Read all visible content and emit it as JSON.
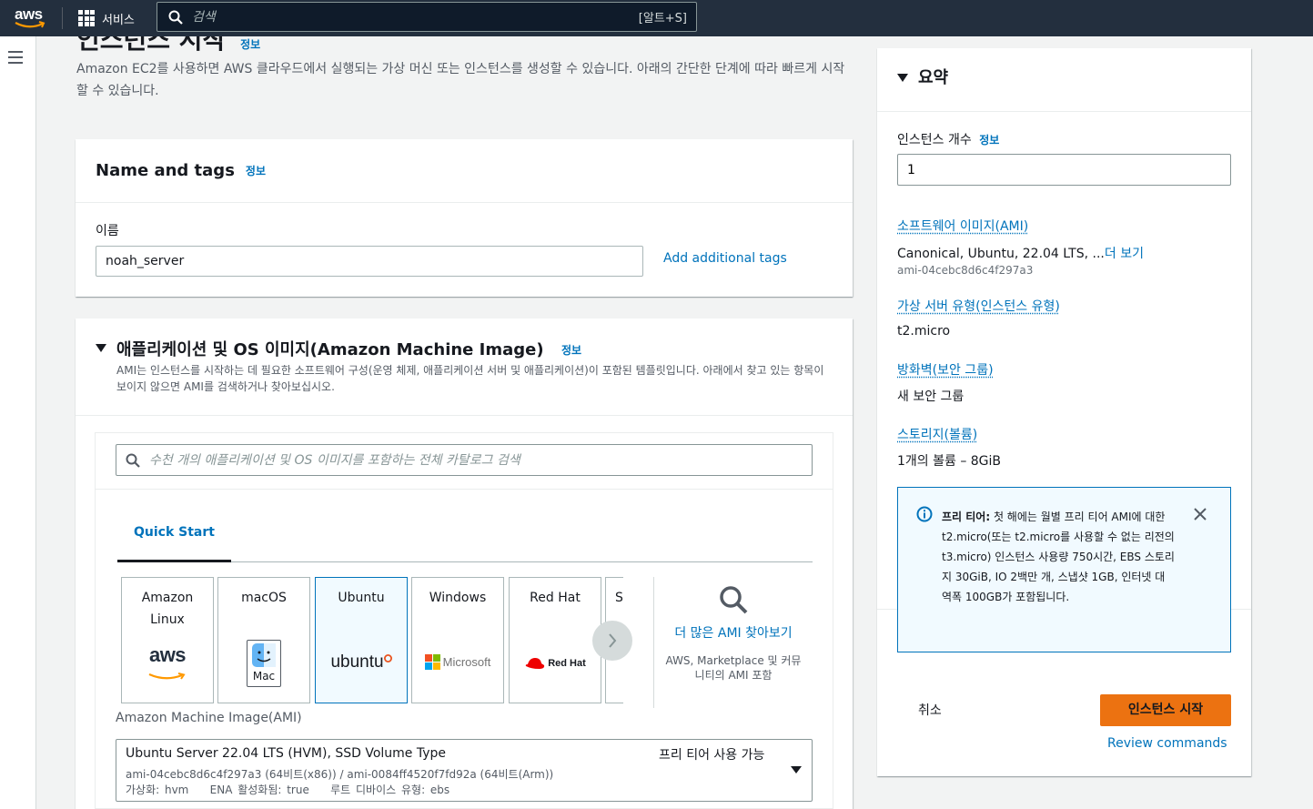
{
  "topnav": {
    "logo": "aws",
    "services_label": "서비스",
    "search_placeholder": "검색",
    "search_shortcut": "[알트+S]"
  },
  "page": {
    "title": "인스턴스 시작",
    "title_info": "정보",
    "intro": "Amazon EC2를 사용하면 AWS 클라우드에서 실행되는 가상 머신 또는 인스턴스를 생성할 수 있습니다. 아래의 간단한 단계에 따라 빠르게 시작할 수 있습니다."
  },
  "name_tags": {
    "title": "Name and tags",
    "info": "정보",
    "name_label": "이름",
    "name_value": "noah_server",
    "add_tags": "Add additional tags"
  },
  "ami": {
    "title": "애플리케이션 및 OS 이미지(Amazon Machine Image)",
    "info": "정보",
    "description": "AMI는 인스턴스를 시작하는 데 필요한 소프트웨어 구성(운영 체제, 애플리케이션 서버 및 애플리케이션)이 포함된 템플릿입니다. 아래에서 찾고 있는 항목이 보이지 않으면 AMI를 검색하거나 찾아보십시오.",
    "search_placeholder": "수천 개의 애플리케이션 및 OS 이미지를 포함하는 전체 카탈로그 검색",
    "tab_label": "Quick Start",
    "os_tiles": [
      {
        "name": "Amazon Linux",
        "logo": "aws"
      },
      {
        "name": "macOS",
        "logo": "Mac"
      },
      {
        "name": "Ubuntu",
        "logo": "ubuntu"
      },
      {
        "name": "Windows",
        "logo": "Microsoft"
      },
      {
        "name": "Red Hat",
        "logo": "Red Hat"
      },
      {
        "name": "S",
        "logo": ""
      }
    ],
    "find_more": "더 많은 AMI 찾아보기",
    "find_more_sub": "AWS, Marketplace 및 커뮤니티의 AMI 포함",
    "ami_label": "Amazon Machine Image(AMI)",
    "selected_ami": {
      "name": "Ubuntu Server 22.04 LTS (HVM), SSD Volume Type",
      "ids": "ami-04cebc8d6c4f297a3 (64비트(x86)) / ami-0084ff4520f7fd92a (64비트(Arm))",
      "details": "가상화: hvm    ENA 활성화됨: true    루트 디바이스 유형: ebs",
      "badge": "프리 티어 사용 가능"
    }
  },
  "summary": {
    "title": "요약",
    "count_label": "인스턴스 개수",
    "count_info": "정보",
    "count_value": "1",
    "software_image_label": "소프트웨어 이미지(AMI)",
    "software_image_value": "Canonical, Ubuntu, 22.04 LTS, ...",
    "see_more": "더 보기",
    "software_image_id": "ami-04cebc8d6c4f297a3",
    "instance_type_label": "가상 서버 유형(인스턴스 유형)",
    "instance_type_value": "t2.micro",
    "firewall_label": "방화벽(보안 그룹)",
    "firewall_value": "새 보안 그룹",
    "storage_label": "스토리지(볼륨)",
    "storage_value": "1개의 볼륨 – 8GiB",
    "free_tier_title": "프리 티어:",
    "free_tier_text": " 첫 해에는 월별 프리 티어 AMI에 대한 t2.micro(또는 t2.micro를 사용할 수 없는 리전의 t3.micro) 인스턴스 사용량 750시간, EBS 스토리지 30GiB, IO 2백만 개, 스냅샷 1GB, 인터넷 대역폭 100GB가 포함됩니다.",
    "cancel": "취소",
    "launch": "인스턴스 시작",
    "review": "Review commands"
  },
  "colors": {
    "nav_bg": "#232f3e",
    "link": "#0073bb",
    "primary": "#ec7211"
  }
}
